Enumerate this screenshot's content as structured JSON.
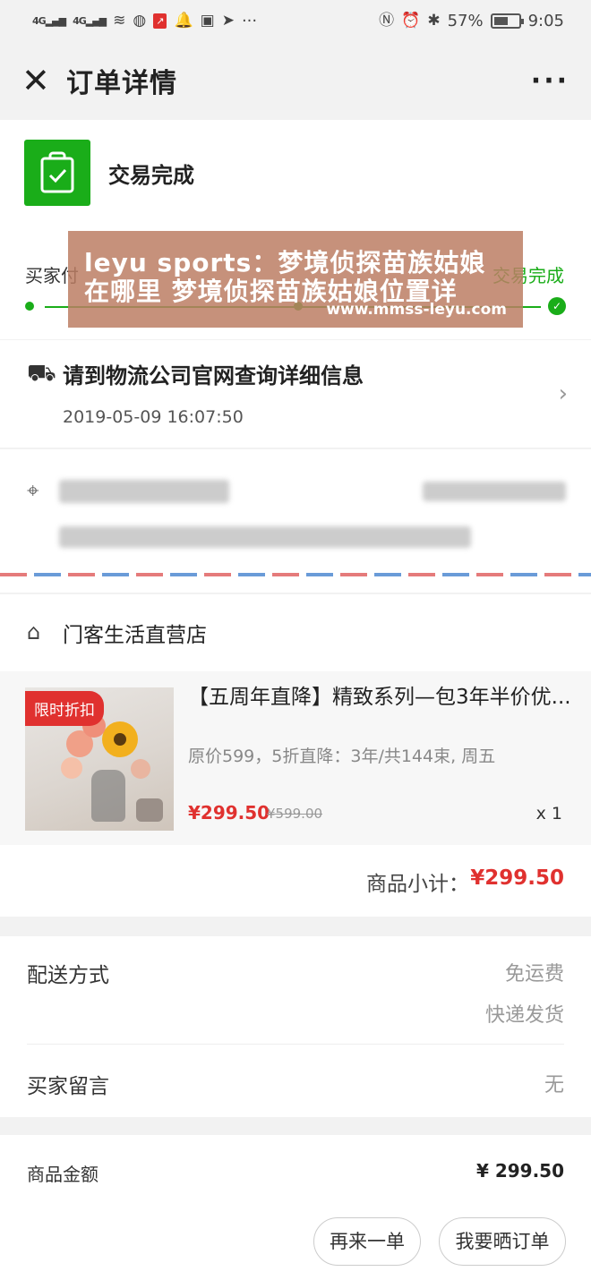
{
  "status_bar": {
    "signal1": "4G",
    "signal2": "4G",
    "battery": "57%",
    "battery_level": 0.57,
    "time": "9:05",
    "more": "···"
  },
  "nav": {
    "title": "订单详情",
    "close_icon": "close-icon",
    "more_label": "···"
  },
  "order_status": {
    "text": "交易完成",
    "icon": "shopping-bag-check-icon",
    "icon_color": "#1aad19"
  },
  "progress": {
    "start_label": "买家付",
    "end_label": "交易完成",
    "accent": "#1aad19"
  },
  "watermark": {
    "line1": "leyu sports：梦境侦探苗族姑娘",
    "line2": "在哪里 梦境侦探苗族姑娘位置详",
    "url": "www.mmss-leyu.com"
  },
  "logistics": {
    "title": "请到物流公司官网查询详细信息",
    "time": "2019-05-09 16:07:50",
    "icon": "truck-icon"
  },
  "store": {
    "name": "门客生活直营店",
    "icon": "store-icon"
  },
  "item": {
    "badge": "限时折扣",
    "title": "【五周年直降】精致系列—包3年半价优...",
    "desc": "原价599，5折直降：3年/共144束, 周五",
    "price": "¥299.50",
    "original_price": "¥599.00",
    "qty": "x 1",
    "price_color": "#e0312f"
  },
  "subtotal": {
    "label": "商品小计：",
    "value": "¥299.50"
  },
  "delivery": {
    "method_label": "配送方式",
    "method_value": "免运费",
    "method_sub": "快递发货",
    "message_label": "买家留言",
    "message_value": "无"
  },
  "amount": {
    "label": "商品金额",
    "value": "¥ 299.50"
  },
  "actions": {
    "reorder": "再来一单",
    "share": "我要晒订单"
  }
}
